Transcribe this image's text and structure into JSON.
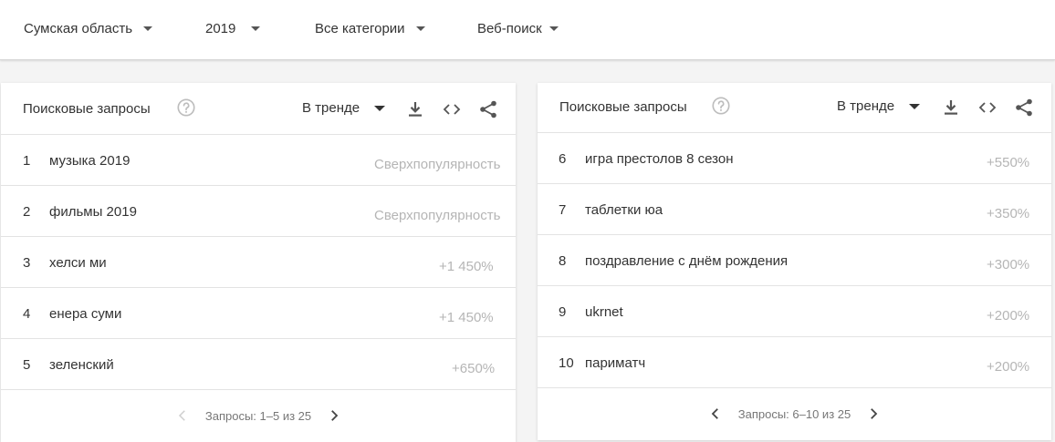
{
  "filters": {
    "region": "Сумская область",
    "year": "2019",
    "category": "Все категории",
    "search_type": "Веб-поиск"
  },
  "left_card": {
    "title": "Поисковые запросы",
    "trend_label": "В тренде",
    "rows": [
      {
        "rank": "1",
        "term": "музыка 2019",
        "value": "Сверхпопулярность"
      },
      {
        "rank": "2",
        "term": "фильмы 2019",
        "value": "Сверхпопулярность"
      },
      {
        "rank": "3",
        "term": "хелси ми",
        "value": "+1 450%"
      },
      {
        "rank": "4",
        "term": "енера суми",
        "value": "+1 450%"
      },
      {
        "rank": "5",
        "term": "зеленский",
        "value": "+650%"
      }
    ],
    "pagination": "Запросы: 1–5 из 25"
  },
  "right_card": {
    "title": "Поисковые запросы",
    "trend_label": "В тренде",
    "rows": [
      {
        "rank": "6",
        "term": "игра престолов 8 сезон",
        "value": "+550%"
      },
      {
        "rank": "7",
        "term": "таблетки юа",
        "value": "+350%"
      },
      {
        "rank": "8",
        "term": "поздравление с днём рождения",
        "value": "+300%"
      },
      {
        "rank": "9",
        "term": "ukrnet",
        "value": "+200%"
      },
      {
        "rank": "10",
        "term": "париматч",
        "value": "+200%"
      }
    ],
    "pagination": "Запросы: 6–10 из 25"
  },
  "icons": {
    "help": "help-circle-icon",
    "download": "download-icon",
    "embed": "code-icon",
    "share": "share-icon",
    "prev": "chevron-left-icon",
    "next": "chevron-right-icon"
  },
  "colors": {
    "background": "#f4f4f4",
    "card": "#ffffff",
    "text": "#333333",
    "muted_value": "#b5b5b5",
    "divider": "#e3e3e3"
  }
}
